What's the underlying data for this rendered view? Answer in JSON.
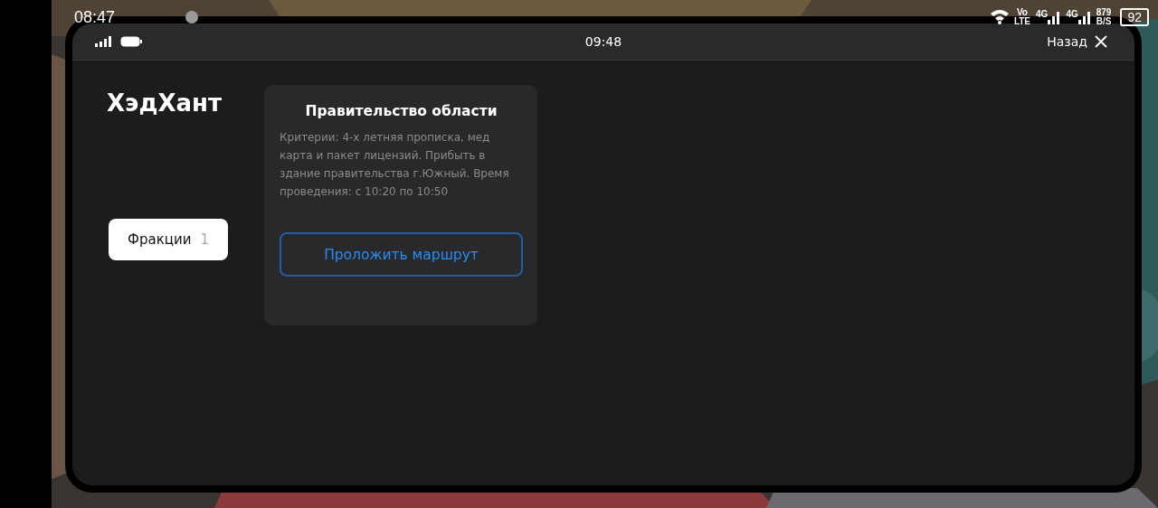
{
  "phone_status_bar": {
    "time": "08:47",
    "volte_top": "Vo",
    "volte_bottom": "LTE",
    "network_1": "4G",
    "network_2": "4G",
    "speed": "879",
    "speed_unit": "B/S",
    "battery": "92"
  },
  "app_bar": {
    "time": "09:48",
    "back": "Назад"
  },
  "sidebar": {
    "title": "ХэдХант",
    "tabs": [
      {
        "label": "Фракции",
        "count": "1",
        "selected": true
      }
    ]
  },
  "card": {
    "title": "Правительство области",
    "description": "Критерии: 4-х летняя прописка, мед карта и пакет лицензий. Прибыть в здание правительства г.Южный. Время проведения: с 10:20 по 10:50",
    "button": "Проложить маршрут"
  }
}
